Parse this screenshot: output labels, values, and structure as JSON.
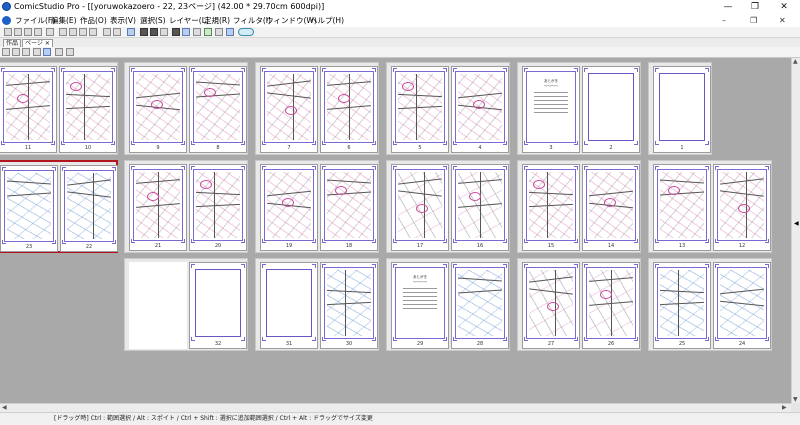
{
  "window": {
    "title": "ComicStudio Pro - [[yoruwokazoero - 22, 23ページ] (42.00 * 29.70cm 600dpi)]",
    "minimize_glyph": "—",
    "restore_glyph": "❐",
    "close_glyph": "✕"
  },
  "menu": {
    "items": [
      "ファイル(F)",
      "編集(E)",
      "作品(O)",
      "表示(V)",
      "選択(S)",
      "レイヤー(L)",
      "定規(R)",
      "フィルタ(I)",
      "ウィンドウ(W)",
      "ヘルプ(H)"
    ],
    "doc_minimize": "–",
    "doc_restore": "❐",
    "doc_close": "✕"
  },
  "tabs": [
    {
      "label": "作品"
    },
    {
      "label": "ページ",
      "close": "✕"
    }
  ],
  "rows": [
    {
      "spreads": [
        {
          "pages": [
            {
              "num": "11",
              "style": "red"
            },
            {
              "num": "10",
              "style": "red"
            }
          ]
        },
        {
          "pages": [
            {
              "num": "9",
              "style": "red"
            },
            {
              "num": "8",
              "style": "red"
            }
          ]
        },
        {
          "pages": [
            {
              "num": "7",
              "style": "red"
            },
            {
              "num": "6",
              "style": "red"
            }
          ]
        },
        {
          "pages": [
            {
              "num": "5",
              "style": "red"
            },
            {
              "num": "4",
              "style": "red"
            }
          ]
        },
        {
          "pages": [
            {
              "num": "3",
              "style": "text"
            },
            {
              "num": "2",
              "style": "blank"
            }
          ]
        },
        {
          "pages": [
            {
              "num": "1",
              "style": "blank"
            }
          ]
        }
      ]
    },
    {
      "spreads": [
        {
          "pages": [
            {
              "num": "23",
              "style": "blue"
            },
            {
              "num": "22",
              "style": "blue"
            }
          ],
          "selected": true
        },
        {
          "pages": [
            {
              "num": "21",
              "style": "red"
            },
            {
              "num": "20",
              "style": "red"
            }
          ]
        },
        {
          "pages": [
            {
              "num": "19",
              "style": "red"
            },
            {
              "num": "18",
              "style": "red"
            }
          ]
        },
        {
          "pages": [
            {
              "num": "17",
              "style": "grey"
            },
            {
              "num": "16",
              "style": "grey"
            }
          ]
        },
        {
          "pages": [
            {
              "num": "15",
              "style": "red"
            },
            {
              "num": "14",
              "style": "red"
            }
          ]
        },
        {
          "pages": [
            {
              "num": "13",
              "style": "red"
            },
            {
              "num": "12",
              "style": "red"
            }
          ]
        }
      ]
    },
    {
      "spreads": [
        {
          "pages": [
            {
              "num": "",
              "style": "empty"
            },
            {
              "num": "32",
              "style": "blank"
            }
          ]
        },
        {
          "pages": [
            {
              "num": "31",
              "style": "blank"
            },
            {
              "num": "30",
              "style": "blue"
            }
          ]
        },
        {
          "pages": [
            {
              "num": "29",
              "style": "text"
            },
            {
              "num": "28",
              "style": "blue"
            }
          ]
        },
        {
          "pages": [
            {
              "num": "27",
              "style": "grey"
            },
            {
              "num": "26",
              "style": "grey"
            }
          ]
        },
        {
          "pages": [
            {
              "num": "25",
              "style": "blue"
            },
            {
              "num": "24",
              "style": "blue"
            }
          ]
        }
      ]
    }
  ],
  "text_page": {
    "heading": "あとがき",
    "sub": "〜〜〜〜"
  },
  "status": {
    "text": "[ドラッグ時] Ctrl : 範囲選択 / Alt : スポイト / Ctrl + Shift : 選択に追加範囲選択 / Ctrl + Alt : ドラッグでサイズ変更"
  },
  "scroll": {
    "up": "▲",
    "down": "▼",
    "left": "◀",
    "right": "▶",
    "side_pointer": "◀"
  }
}
